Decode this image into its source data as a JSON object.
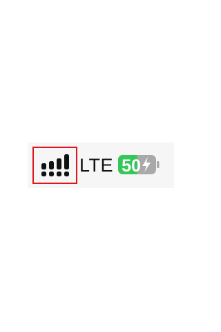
{
  "status_bar": {
    "network_type": "LTE",
    "battery": {
      "level_percent": 50,
      "label": "50",
      "charging": true,
      "fill_color": "#34c759",
      "empty_color": "#a9a9a9"
    },
    "signal": {
      "icon": "cellular-signal-icon",
      "highlighted": true,
      "highlight_color": "#e1141e"
    }
  }
}
